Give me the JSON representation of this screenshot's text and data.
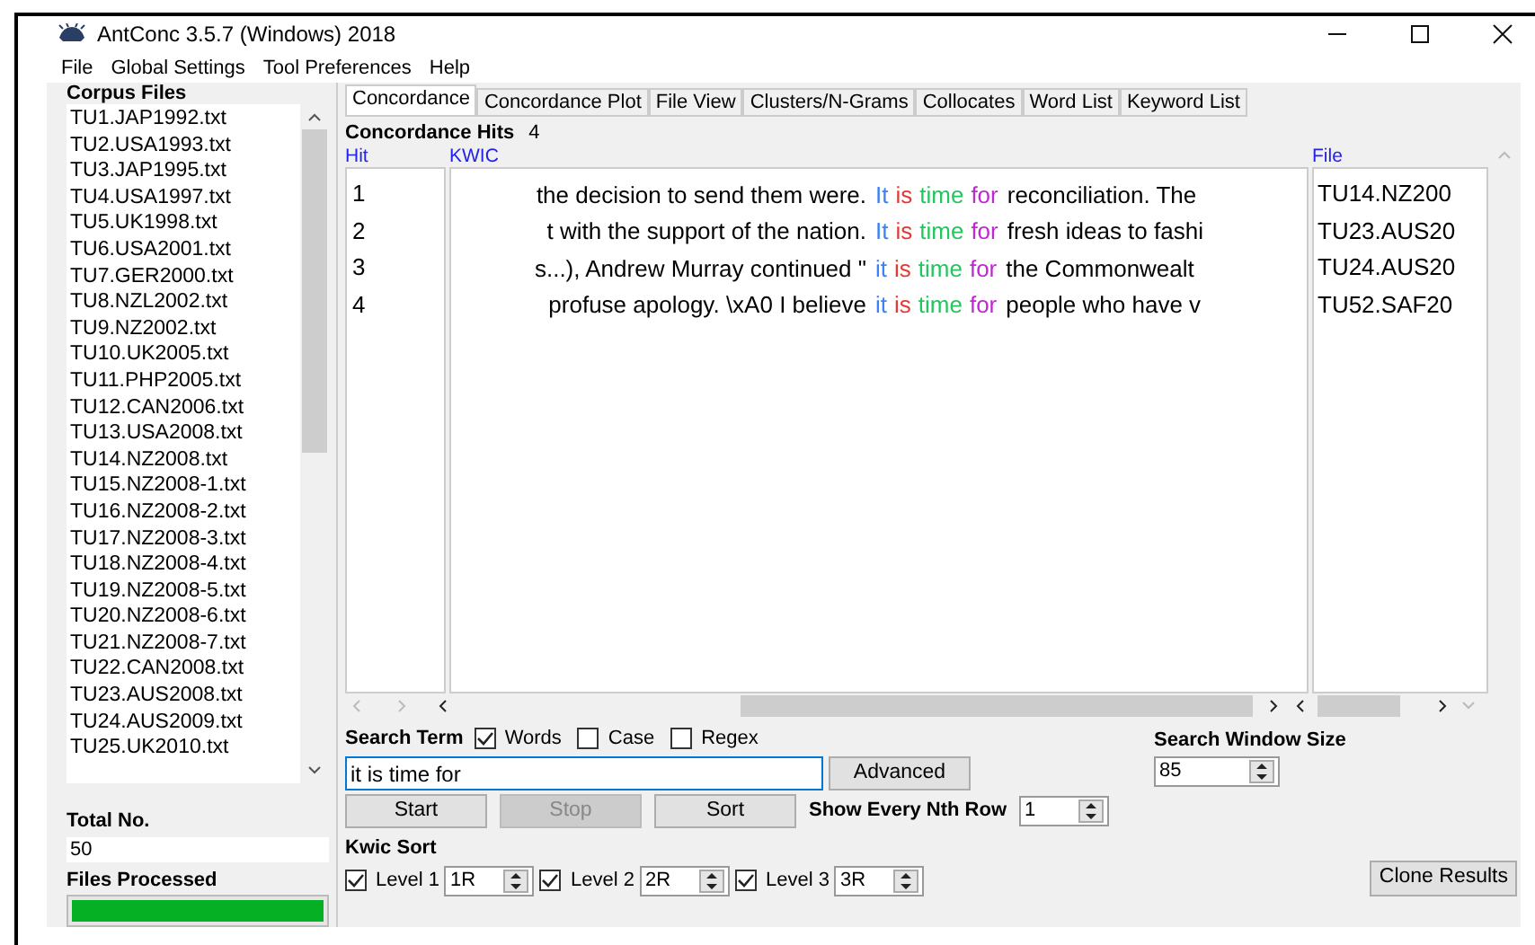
{
  "window": {
    "title": "AntConc 3.5.7 (Windows) 2018"
  },
  "menu": [
    "File",
    "Global Settings",
    "Tool Preferences",
    "Help"
  ],
  "corpus_files": {
    "title": "Corpus Files",
    "items": [
      "TU1.JAP1992.txt",
      "TU2.USA1993.txt",
      "TU3.JAP1995.txt",
      "TU4.USA1997.txt",
      "TU5.UK1998.txt",
      "TU6.USA2001.txt",
      "TU7.GER2000.txt",
      "TU8.NZL2002.txt",
      "TU9.NZ2002.txt",
      "TU10.UK2005.txt",
      "TU11.PHP2005.txt",
      "TU12.CAN2006.txt",
      "TU13.USA2008.txt",
      "TU14.NZ2008.txt",
      "TU15.NZ2008-1.txt",
      "TU16.NZ2008-2.txt",
      "TU17.NZ2008-3.txt",
      "TU18.NZ2008-4.txt",
      "TU19.NZ2008-5.txt",
      "TU20.NZ2008-6.txt",
      "TU21.NZ2008-7.txt",
      "TU22.CAN2008.txt",
      "TU23.AUS2008.txt",
      "TU24.AUS2009.txt",
      "TU25.UK2010.txt"
    ]
  },
  "total_no": {
    "label": "Total No.",
    "value": "50"
  },
  "files_processed": {
    "label": "Files Processed",
    "level": 1
  },
  "tabs": [
    {
      "label": "Concordance",
      "selected": true
    },
    {
      "label": "Concordance Plot",
      "selected": false
    },
    {
      "label": "File View",
      "selected": false
    },
    {
      "label": "Clusters/N-Grams",
      "selected": false
    },
    {
      "label": "Collocates",
      "selected": false
    },
    {
      "label": "Word List",
      "selected": false
    },
    {
      "label": "Keyword List",
      "selected": false
    }
  ],
  "hits": {
    "label": "Concordance Hits",
    "count": "4"
  },
  "table": {
    "columns": [
      "Hit",
      "KWIC",
      "File"
    ],
    "rows": [
      {
        "hit": "1",
        "left": "the decision to send them were.",
        "key": [
          {
            "text": "It",
            "color": "#3b82f6"
          },
          {
            "text": "is",
            "color": "#e53935"
          },
          {
            "text": "time",
            "color": "#22c55e"
          },
          {
            "text": "for",
            "color": "#c026d3"
          }
        ],
        "right": "reconciliation. The",
        "file": "TU14.NZ200"
      },
      {
        "hit": "2",
        "left": "t with the support of the nation.",
        "key": [
          {
            "text": "It",
            "color": "#3b82f6"
          },
          {
            "text": "is",
            "color": "#e53935"
          },
          {
            "text": "time",
            "color": "#22c55e"
          },
          {
            "text": "for",
            "color": "#c026d3"
          }
        ],
        "right": "fresh ideas to fashi",
        "file": "TU23.AUS20"
      },
      {
        "hit": "3",
        "left": "s...), Andrew Murray continued \"",
        "key": [
          {
            "text": "it",
            "color": "#3b82f6"
          },
          {
            "text": "is",
            "color": "#e53935"
          },
          {
            "text": "time",
            "color": "#22c55e"
          },
          {
            "text": "for",
            "color": "#c026d3"
          }
        ],
        "right": "the Commonwealt",
        "file": "TU24.AUS20"
      },
      {
        "hit": "4",
        "left": "profuse apology. \\xA0 I believe",
        "key": [
          {
            "text": "it",
            "color": "#3b82f6"
          },
          {
            "text": "is",
            "color": "#e53935"
          },
          {
            "text": "time",
            "color": "#22c55e"
          },
          {
            "text": "for",
            "color": "#c026d3"
          }
        ],
        "right": "people who have v",
        "file": "TU52.SAF20"
      }
    ]
  },
  "search": {
    "label": "Search Term",
    "options": [
      {
        "label": "Words",
        "checked": true
      },
      {
        "label": "Case",
        "checked": false
      },
      {
        "label": "Regex",
        "checked": false
      }
    ],
    "value": "it is time for",
    "advanced": "Advanced"
  },
  "buttons": [
    {
      "label": "Start",
      "disabled": false
    },
    {
      "label": "Stop",
      "disabled": true
    },
    {
      "label": "Sort",
      "disabled": false
    }
  ],
  "nth_row": {
    "label": "Show Every Nth Row",
    "value": "1"
  },
  "window_size": {
    "label": "Search Window Size",
    "value": "85"
  },
  "kwic_sort": {
    "label": "Kwic Sort",
    "levels": [
      {
        "label": "Level 1",
        "checked": true,
        "value": "1R"
      },
      {
        "label": "Level 2",
        "checked": true,
        "value": "2R"
      },
      {
        "label": "Level 3",
        "checked": true,
        "value": "3R"
      }
    ]
  },
  "clone": "Clone Results"
}
